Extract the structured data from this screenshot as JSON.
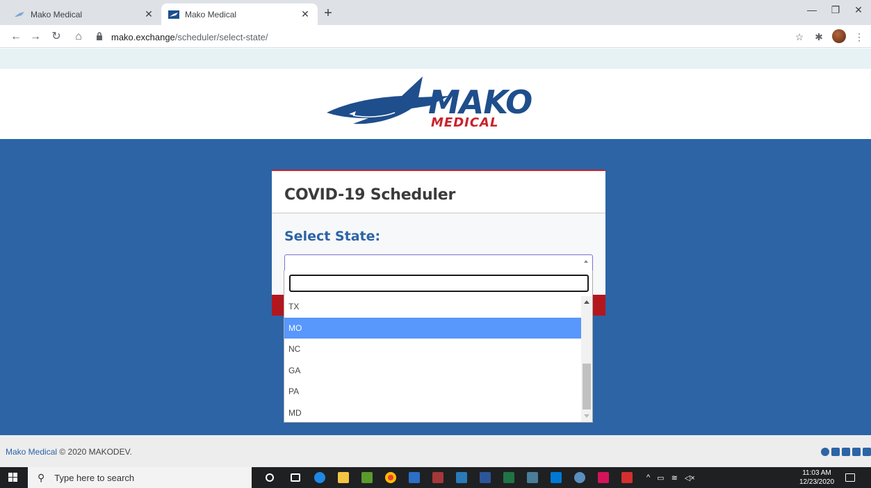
{
  "browser": {
    "tabs": [
      {
        "title": "Mako Medical",
        "active": false
      },
      {
        "title": "Mako Medical",
        "active": true
      }
    ],
    "new_tab": "+",
    "url_host": "mako.exchange",
    "url_path": "/scheduler/select-state/"
  },
  "brand": {
    "logo_top": "MAKO",
    "logo_bottom": "MEDICAL"
  },
  "card": {
    "title": "COVID-19 Scheduler",
    "select_label": "Select State:",
    "select_value": ""
  },
  "dropdown": {
    "search_value": "",
    "options": [
      "TX",
      "MO",
      "NC",
      "GA",
      "PA",
      "MD"
    ],
    "highlighted": "MO"
  },
  "footer": {
    "brand_link": "Mako Medical",
    "copyright": " © 2020 MAKODEV."
  },
  "taskbar": {
    "search_placeholder": "Type here to search",
    "time": "11:03 AM",
    "date": "12/23/2020"
  },
  "colors": {
    "brand_blue": "#2c64a6",
    "brand_red": "#c8232c",
    "highlight": "#5897fb"
  }
}
